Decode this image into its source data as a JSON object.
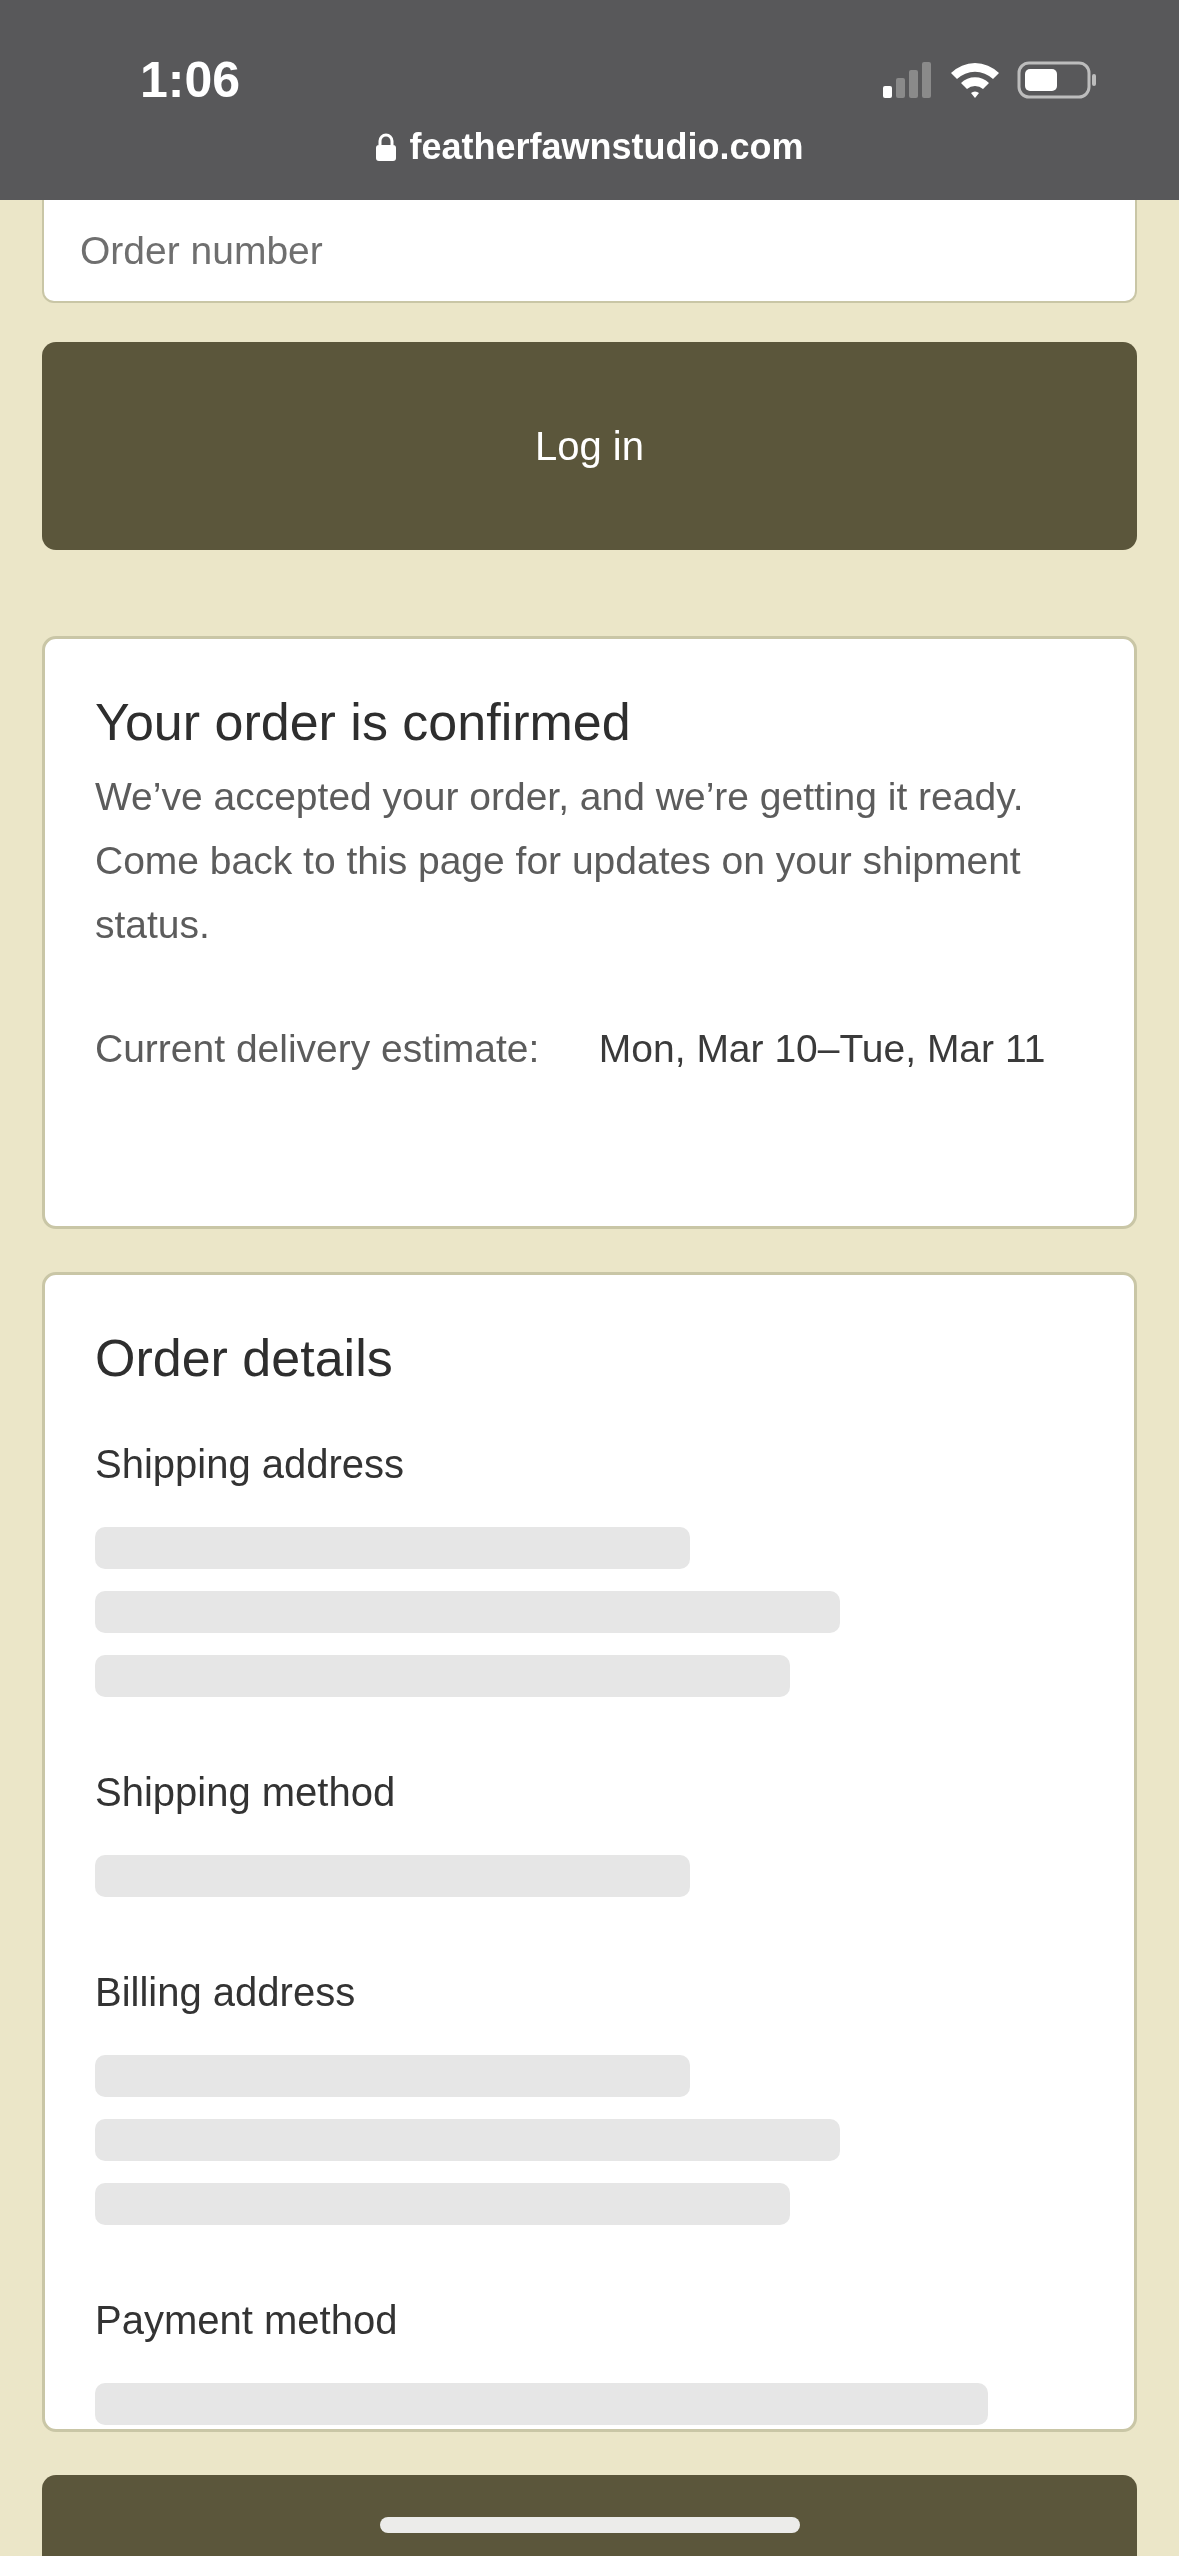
{
  "status_bar": {
    "time": "1:06",
    "url": "featherfawnstudio.com"
  },
  "order_field": {
    "placeholder": "Order number"
  },
  "login_button": {
    "label": "Log in"
  },
  "confirmation": {
    "title": "Your order is confirmed",
    "message": "We’ve accepted your order, and we’re getting it ready. Come back to this page for updates on your shipment status.",
    "delivery_label": "Current delivery estimate:",
    "delivery_value": " Mon, Mar 10–Tue, Mar 11"
  },
  "order_details": {
    "title": "Order details",
    "sections": [
      {
        "heading": "Shipping address",
        "lines": [
          {
            "kind": "short"
          },
          {
            "kind": "long"
          },
          {
            "kind": "medium"
          }
        ]
      },
      {
        "heading": "Shipping method",
        "lines": [
          {
            "kind": "short"
          }
        ]
      },
      {
        "heading": "Billing address",
        "lines": [
          {
            "kind": "short"
          },
          {
            "kind": "long"
          },
          {
            "kind": "medium"
          }
        ]
      },
      {
        "heading": "Payment method",
        "lines": [
          {
            "kind": "full"
          }
        ]
      }
    ]
  }
}
